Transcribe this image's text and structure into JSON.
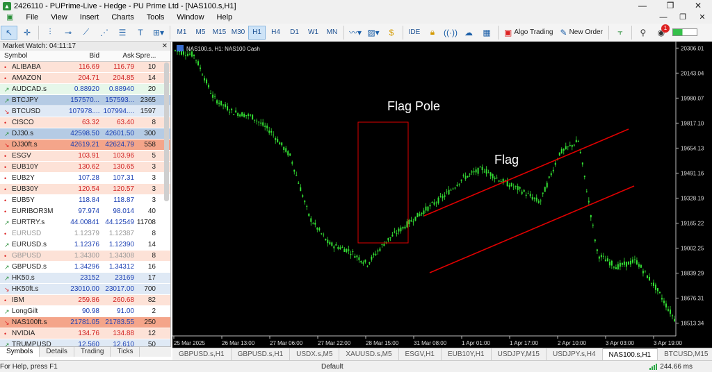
{
  "window": {
    "title": "2426110 - PUPrime-Live - Hedge - PU Prime Ltd - [NAS100.s,H1]",
    "controls": [
      "—",
      "❐",
      "✕"
    ]
  },
  "menu": {
    "items": [
      "File",
      "View",
      "Insert",
      "Charts",
      "Tools",
      "Window",
      "Help"
    ],
    "right": [
      "—",
      "❐",
      "✕"
    ]
  },
  "toolbar": {
    "timeframes": [
      "M1",
      "M5",
      "M15",
      "M30",
      "H1",
      "H4",
      "D1",
      "W1",
      "MN"
    ],
    "active_tf": "H1",
    "ide": "IDE",
    "algo": "Algo Trading",
    "new_order": "New Order",
    "notifications": "1"
  },
  "market_watch": {
    "title": "Market Watch: 04:11:17",
    "headers": [
      "Symbol",
      "Bid",
      "Ask",
      "Spre..."
    ],
    "rows": [
      {
        "a": "•",
        "s": "ALIBABA",
        "b": "116.69",
        "k": "116.79",
        "p": "10",
        "c": "pk"
      },
      {
        "a": "•",
        "s": "AMAZON",
        "b": "204.71",
        "k": "204.85",
        "p": "14",
        "c": "pk"
      },
      {
        "a": "↗",
        "s": "AUDCAD.s",
        "b": "0.88920",
        "k": "0.88940",
        "p": "20",
        "c": "gr"
      },
      {
        "a": "↗",
        "s": "BTCJPY",
        "b": "157570...",
        "k": "157593...",
        "p": "2365",
        "c": "bl"
      },
      {
        "a": "↘",
        "s": "BTCUSD",
        "b": "107978....",
        "k": "107994....",
        "p": "1597",
        "c": "lb"
      },
      {
        "a": "•",
        "s": "CISCO",
        "b": "63.32",
        "k": "63.40",
        "p": "8",
        "c": "pk"
      },
      {
        "a": "↗",
        "s": "DJ30.s",
        "b": "42598.50",
        "k": "42601.50",
        "p": "300",
        "c": "bl"
      },
      {
        "a": "↘",
        "s": "DJ30ft.s",
        "b": "42619.21",
        "k": "42624.79",
        "p": "558",
        "c": "rd"
      },
      {
        "a": "•",
        "s": "ESGV",
        "b": "103.91",
        "k": "103.96",
        "p": "5",
        "c": "pk"
      },
      {
        "a": "•",
        "s": "EUB10Y",
        "b": "130.62",
        "k": "130.65",
        "p": "3",
        "c": "pk"
      },
      {
        "a": "•",
        "s": "EUB2Y",
        "b": "107.28",
        "k": "107.31",
        "p": "3",
        "c": "up"
      },
      {
        "a": "•",
        "s": "EUB30Y",
        "b": "120.54",
        "k": "120.57",
        "p": "3",
        "c": "pk"
      },
      {
        "a": "•",
        "s": "EUB5Y",
        "b": "118.84",
        "k": "118.87",
        "p": "3",
        "c": "up"
      },
      {
        "a": "•",
        "s": "EURIBOR3M",
        "b": "97.974",
        "k": "98.014",
        "p": "40",
        "c": "up"
      },
      {
        "a": "↗",
        "s": "EURTRY.s",
        "b": "44.00841",
        "k": "44.12549",
        "p": "11708",
        "c": "up"
      },
      {
        "a": "•",
        "s": "EURUSD",
        "b": "1.12379",
        "k": "1.12387",
        "p": "8",
        "c": "up",
        "g": true
      },
      {
        "a": "↗",
        "s": "EURUSD.s",
        "b": "1.12376",
        "k": "1.12390",
        "p": "14",
        "c": "up"
      },
      {
        "a": "•",
        "s": "GBPUSD",
        "b": "1.34300",
        "k": "1.34308",
        "p": "8",
        "c": "pk",
        "g": true
      },
      {
        "a": "↗",
        "s": "GBPUSD.s",
        "b": "1.34296",
        "k": "1.34312",
        "p": "16",
        "c": "up"
      },
      {
        "a": "↗",
        "s": "HK50.s",
        "b": "23152",
        "k": "23169",
        "p": "17",
        "c": "lb"
      },
      {
        "a": "↘",
        "s": "HK50ft.s",
        "b": "23010.00",
        "k": "23017.00",
        "p": "700",
        "c": "lb"
      },
      {
        "a": "•",
        "s": "IBM",
        "b": "259.86",
        "k": "260.68",
        "p": "82",
        "c": "pk"
      },
      {
        "a": "↗",
        "s": "LongGilt",
        "b": "90.98",
        "k": "91.00",
        "p": "2",
        "c": "up"
      },
      {
        "a": "↘",
        "s": "NAS100ft.s",
        "b": "21781.05",
        "k": "21783.55",
        "p": "250",
        "c": "rd"
      },
      {
        "a": "•",
        "s": "NVIDIA",
        "b": "134.76",
        "k": "134.88",
        "p": "12",
        "c": "pk"
      },
      {
        "a": "↗",
        "s": "TRUMPUSD",
        "b": "12.560",
        "k": "12.610",
        "p": "50",
        "c": "lb"
      }
    ],
    "tabs": [
      "Symbols",
      "Details",
      "Trading",
      "Ticks"
    ],
    "active_tab": "Symbols"
  },
  "chart": {
    "symbol_label": "NAS100.s, H1:  NAS100 Cash",
    "annotation_pole": "Flag Pole",
    "annotation_flag": "Flag",
    "bg": "#000000",
    "candle_color": "#33e033",
    "line_color": "#e00000"
  },
  "chart_data": {
    "type": "line",
    "x": [
      "25 Mar 2025",
      "26 Mar 13:00",
      "27 Mar 06:00",
      "27 Mar 22:00",
      "28 Mar 15:00",
      "31 Mar 08:00",
      "1 Apr 01:00",
      "1 Apr 17:00",
      "2 Apr 10:00",
      "3 Apr 03:00",
      "3 Apr 19:00"
    ],
    "y_ticks": [
      "20306.01",
      "20143.04",
      "19980.07",
      "19817.10",
      "19654.13",
      "19491.16",
      "19328.19",
      "19165.22",
      "19002.25",
      "18839.29",
      "18676.31",
      "18513.34"
    ],
    "ylim": [
      18430,
      20330
    ],
    "series": [
      {
        "values": [
          20290,
          20260,
          19980,
          19890,
          19860,
          19760,
          19600,
          19200,
          19030,
          18990,
          18900,
          19050,
          19150,
          19250,
          19340,
          19460,
          19520,
          19440,
          19380,
          19300,
          19620,
          19700,
          18960,
          18880,
          18920,
          18750,
          18540
        ]
      }
    ]
  },
  "chart_tabs": {
    "items": [
      "GBPUSD.s,H1",
      "GBPUSD.s,H1",
      "USDX.s,M5",
      "XAUUSD.s,M5",
      "ESGV,H1",
      "EUB10Y,H1",
      "USDJPY,M15",
      "USDJPY.s,H4",
      "NAS100.s,H1",
      "BTCUSD,M15"
    ],
    "active": "NAS100.s,H1"
  },
  "status": {
    "help": "For Help, press F1",
    "profile": "Default",
    "ping": "244.66 ms"
  }
}
